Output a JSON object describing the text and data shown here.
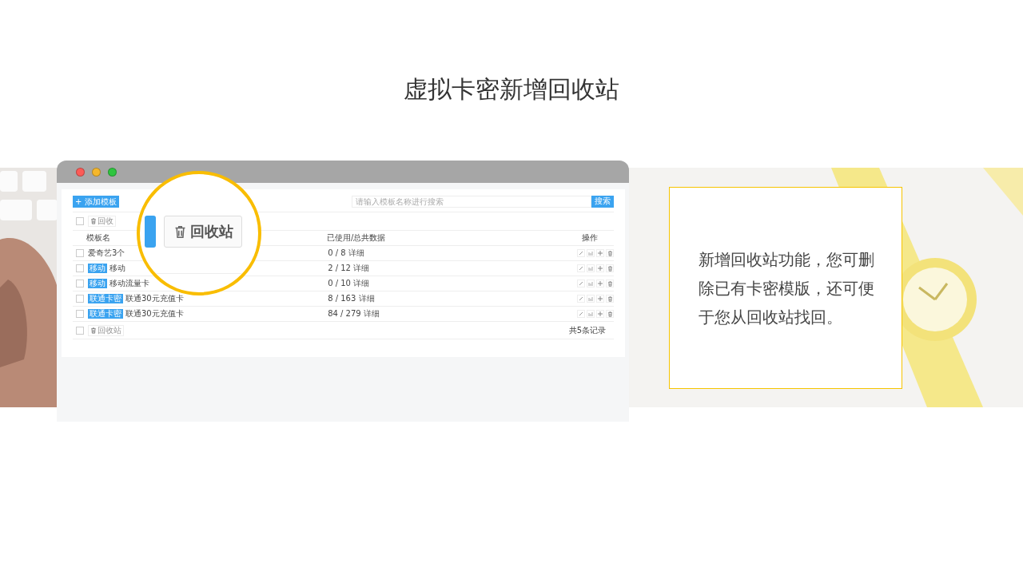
{
  "title": "虚拟卡密新增回收站",
  "toolbar": {
    "add_button": "+ 添加模板",
    "search": {
      "placeholder": "请输入模板名称进行搜索"
    },
    "search_button": "搜索"
  },
  "bulk_bar": {
    "checked": false,
    "recycle_button": "回收"
  },
  "table": {
    "columns": [
      "模板名",
      "已使用/总共数据",
      "操作"
    ],
    "rows": [
      {
        "checked": false,
        "name": "爱奇艺3个",
        "usage": "0 / 8",
        "link": "详细"
      },
      {
        "checked": false,
        "tag": "移动",
        "name": "移动",
        "usage": "2 / 12",
        "link": "详细"
      },
      {
        "checked": false,
        "tag": "移动",
        "name": "移动流量卡",
        "usage": "0 / 10",
        "link": "详细"
      },
      {
        "checked": false,
        "tag": "联通卡密",
        "name": "联通30元充值卡",
        "usage": "8 / 163",
        "link": "详细"
      },
      {
        "checked": false,
        "tag": "联通卡密",
        "name": "联通30元充值卡",
        "usage": "84 / 279",
        "link": "详细"
      }
    ]
  },
  "footer": {
    "checked": false,
    "recycle_button": "回收站",
    "count": "共5条记录"
  },
  "magnifier": {
    "button": "回收站"
  },
  "card": {
    "text": "新增回收站功能，您可删除已有卡密模版，还可便于您从回收站找回。"
  }
}
